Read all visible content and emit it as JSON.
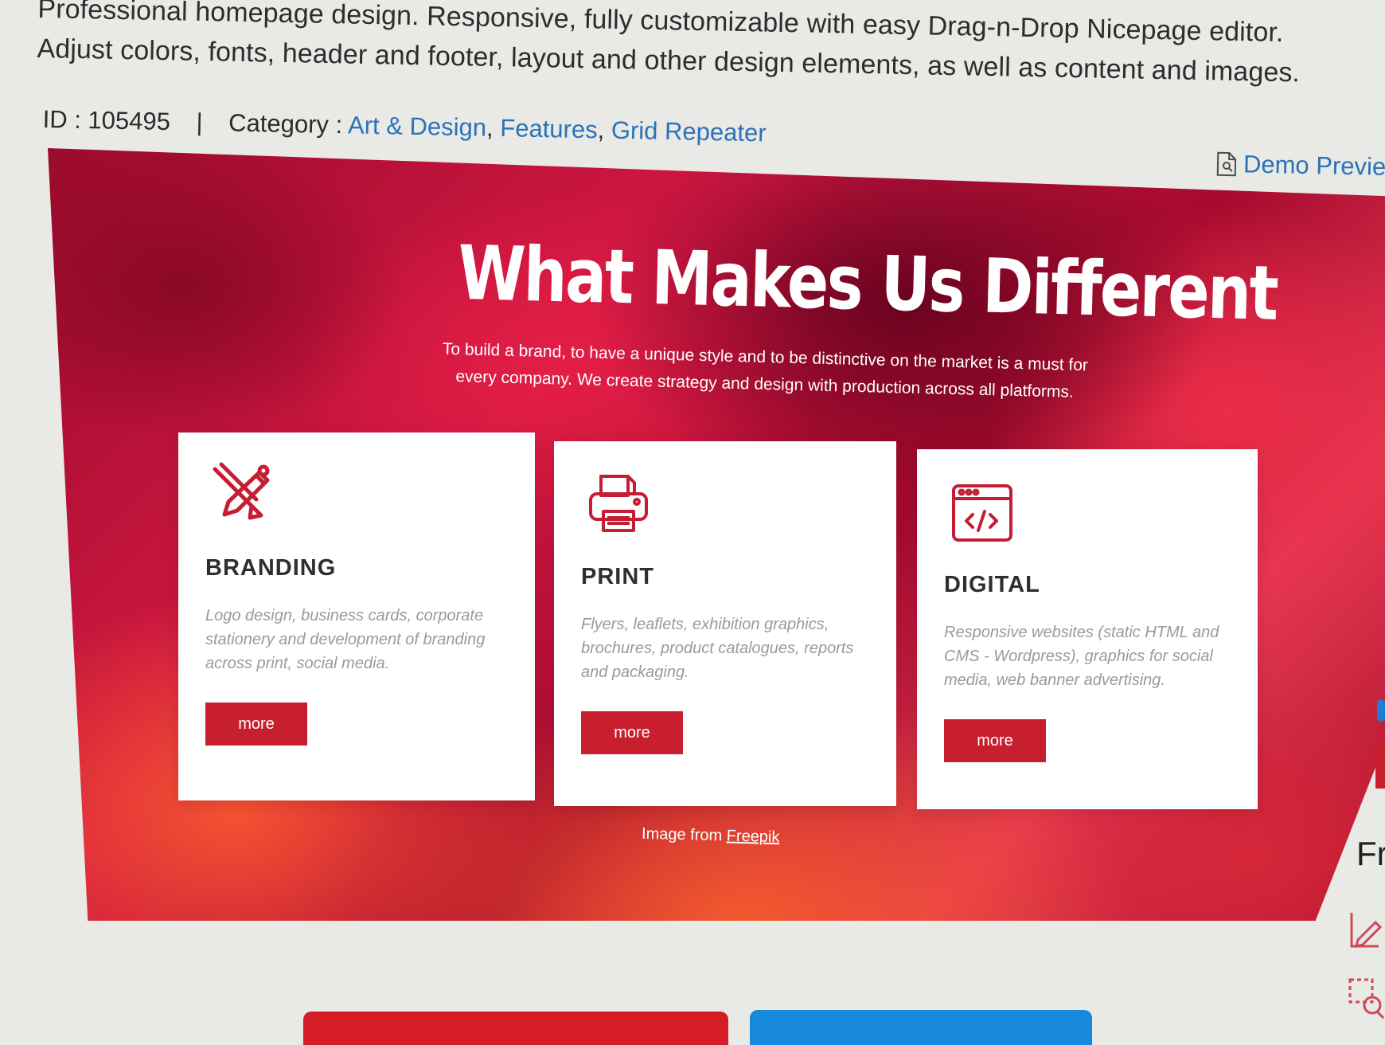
{
  "header": {
    "description": "Professional homepage design. Responsive, fully customizable with easy Drag-n-Drop Nicepage editor. Adjust colors, fonts, header and footer, layout and other design elements, as well as content and images.",
    "id_label": "ID : 105495",
    "separator": "|",
    "category_label": "Category :",
    "categories": [
      "Art & Design",
      "Features",
      "Grid Repeater"
    ],
    "category_separators": [
      ",",
      ","
    ],
    "demo_preview": "Demo Preview"
  },
  "preview": {
    "headline": "What Makes Us Different",
    "subtitle": "To build a brand, to have a unique style and to be distinctive on the market is a must for every company. We create strategy and design with production across all platforms.",
    "cards": [
      {
        "title": "BRANDING",
        "text": "Logo design, business cards, corporate stationery and development of branding across print, social media.",
        "button": "more",
        "icon": "pencil-icon"
      },
      {
        "title": "PRINT",
        "text": "Flyers, leaflets, exhibition graphics, brochures, product catalogues, reports and packaging.",
        "button": "more",
        "icon": "printer-icon"
      },
      {
        "title": "DIGITAL",
        "text": "Responsive websites (static HTML and CMS - Wordpress), graphics for social media, web banner advertising.",
        "button": "more",
        "icon": "code-window-icon"
      }
    ],
    "image_credit_prefix": "Image from",
    "image_credit_link": "Freepik"
  },
  "right_edge": {
    "text": "Fr"
  },
  "colors": {
    "accent_red": "#c81f2f",
    "link_blue": "#2a73b8",
    "bottom_blue": "#1689dd"
  }
}
